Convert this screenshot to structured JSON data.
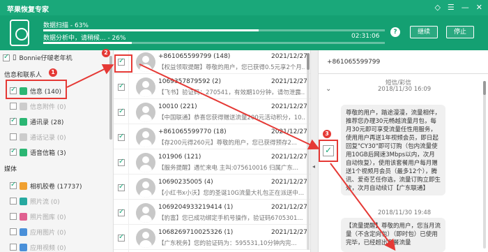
{
  "app": {
    "title": "苹果恢复专家"
  },
  "progress": {
    "scan_label": "数据扫描 - 63%",
    "scan_value": 0.63,
    "analyze_label": "数据分析中，请稍候... - 26%",
    "analyze_value": 0.26,
    "elapsed": "02:31:06",
    "continue_label": "继续",
    "stop_label": "停止"
  },
  "sidebar": {
    "device": "Bonnie仔啵老年机",
    "section_info": "信息和联系人",
    "section_media": "媒体",
    "items_info": [
      {
        "label": "信息 (140)",
        "checked": true,
        "dim": false
      },
      {
        "label": "信息附件 (0)",
        "checked": false,
        "dim": true
      },
      {
        "label": "通讯录 (28)",
        "checked": true,
        "dim": false
      },
      {
        "label": "通话记录 (0)",
        "checked": false,
        "dim": true
      },
      {
        "label": "语音信箱 (3)",
        "checked": true,
        "dim": false
      }
    ],
    "items_media": [
      {
        "label": "相机胶卷 (17737)",
        "checked": true,
        "dim": false
      },
      {
        "label": "照片流 (0)",
        "checked": false,
        "dim": true
      },
      {
        "label": "照片图库 (0)",
        "checked": false,
        "dim": true
      },
      {
        "label": "应用图片 (0)",
        "checked": false,
        "dim": true
      },
      {
        "label": "应用视频 (0)",
        "checked": false,
        "dim": true
      }
    ]
  },
  "messages": [
    {
      "number": "+861065599799 (148)",
      "date": "2021/12/27",
      "preview": "【权益领取提醒】尊敬的用户，您已获得0.5元享2个月..."
    },
    {
      "number": "1069357879592 (2)",
      "date": "2021/12/27",
      "preview": "【飞书】验证码：270541，有效期10分钟，请勿泄露..."
    },
    {
      "number": "10010 (221)",
      "date": "2021/12/27",
      "preview": "【中国联通】恭喜您获得赠送流量200元活动积分，10..."
    },
    {
      "number": "+861065599770 (18)",
      "date": "2021/12/27",
      "preview": "【存200元得260元】尊敬的用户，您已获得预存2..."
    },
    {
      "number": "101906 (121)",
      "date": "2021/12/27",
      "preview": "【服务提醒】遇忙来电 主叫:075610016 归属广东..."
    },
    {
      "number": "10690235005 (4)",
      "date": "2021/12/27",
      "preview": "【小红书x小沃】您的圣诞10G流量大礼包正在派送中..."
    },
    {
      "number": "1069204933219414 (1)",
      "date": "2021/12/27",
      "preview": "【豹富】您已成功绑定手机号操作，验证码6705301..."
    },
    {
      "number": "1068269710025326 (1)",
      "date": "2021/12/27",
      "preview": "【广东税务】您的验证码为：595531,10分钟内完..."
    }
  ],
  "detail": {
    "number": "+861065599799",
    "category": "短信/彩信",
    "date1": "2018/11/30 16:09",
    "bubble1": "尊敬的用户，踏途漫漫，流量相伴，推荐您办理30元畅越流量月包，每月30元即可享受流量任性用服务，使用用户再送1年视频会员，即日起回复\"CY30\"即可订购（包内流量使用10GB后网速3Mbps以内，次月自动恢复），使用该套餐用户每月赠送1个视频月会员（最多12个），腾讯、爱奇艺任你选，流量订购立即生效，次月自动续订【广东联通】",
    "date2": "2018/11/30 19:48",
    "bubble2": "【流量提醒】尊敬的用户，您当月流量（不含定向包）（即时包）已使用完毕，已经超出套餐流量"
  },
  "annotations": [
    "1",
    "2",
    "3"
  ],
  "colors": {
    "brand": "#1aa87a",
    "accent": "#e53935"
  }
}
